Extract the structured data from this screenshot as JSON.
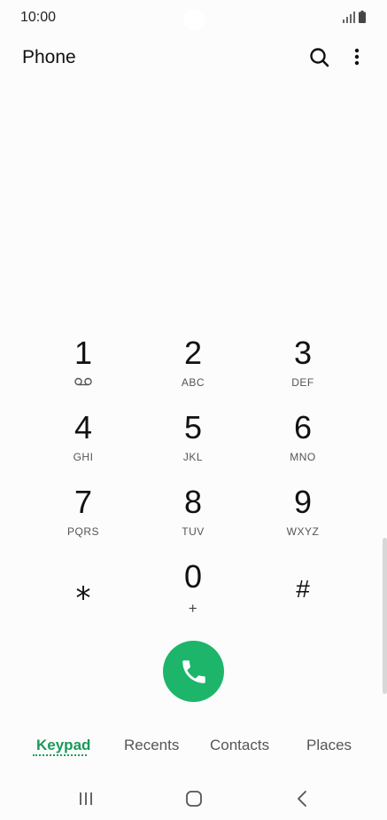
{
  "status_bar": {
    "time": "10:00",
    "icons": [
      "signal-icon",
      "battery-icon"
    ]
  },
  "header": {
    "title": "Phone",
    "actions": [
      "search-icon",
      "more-options-icon"
    ]
  },
  "keypad": {
    "keys": [
      {
        "digit": "1",
        "sub": "",
        "sub_icon": "voicemail-icon"
      },
      {
        "digit": "2",
        "sub": "ABC"
      },
      {
        "digit": "3",
        "sub": "DEF"
      },
      {
        "digit": "4",
        "sub": "GHI"
      },
      {
        "digit": "5",
        "sub": "JKL"
      },
      {
        "digit": "6",
        "sub": "MNO"
      },
      {
        "digit": "7",
        "sub": "PQRS"
      },
      {
        "digit": "8",
        "sub": "TUV"
      },
      {
        "digit": "9",
        "sub": "WXYZ"
      },
      {
        "digit": "⁎",
        "sub": ""
      },
      {
        "digit": "0",
        "sub": "+"
      },
      {
        "digit": "#",
        "sub": ""
      }
    ]
  },
  "call_button": {
    "icon": "phone-icon",
    "color": "#1db56a"
  },
  "tabs": [
    {
      "label": "Keypad",
      "active": true
    },
    {
      "label": "Recents",
      "active": false
    },
    {
      "label": "Contacts",
      "active": false
    },
    {
      "label": "Places",
      "active": false
    }
  ],
  "accent_color": "#1a9a5c",
  "nav_bar": {
    "buttons": [
      "recent-apps-icon",
      "home-icon",
      "back-icon"
    ]
  }
}
